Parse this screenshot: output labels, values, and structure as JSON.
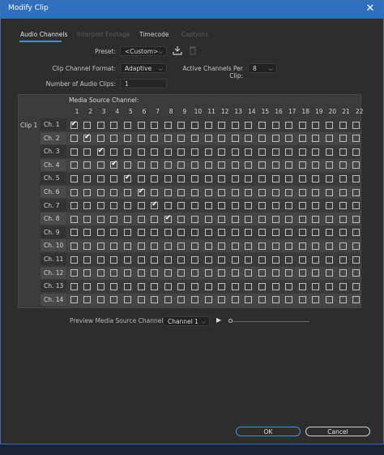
{
  "window": {
    "title": "Modify Clip",
    "close_glyph": "✕"
  },
  "tabs": [
    {
      "label": "Audio Channels",
      "state": "active"
    },
    {
      "label": "Interpret Footage",
      "state": "disabled"
    },
    {
      "label": "Timecode",
      "state": "normal"
    },
    {
      "label": "Captions",
      "state": "disabled"
    }
  ],
  "form": {
    "preset_label": "Preset:",
    "preset_value": "<Custom>",
    "format_label": "Clip Channel Format:",
    "format_value": "Adaptive",
    "active_label": "Active Channels Per Clip:",
    "active_value": "8",
    "num_clips_label": "Number of Audio Clips:",
    "num_clips_value": "1",
    "dropdown_glyph": "⌵"
  },
  "icons": {
    "save_preset": "save-preset-icon",
    "delete_preset": "delete-preset-icon"
  },
  "matrix": {
    "header": "Media Source Channel:",
    "columns": [
      "1",
      "2",
      "3",
      "4",
      "5",
      "6",
      "7",
      "8",
      "9",
      "10",
      "11",
      "12",
      "13",
      "14",
      "15",
      "16",
      "17",
      "18",
      "19",
      "20",
      "21",
      "22"
    ],
    "clip_label": "Clip 1",
    "rows": [
      "Ch. 1",
      "Ch. 2",
      "Ch. 3",
      "Ch. 4",
      "Ch. 5",
      "Ch. 6",
      "Ch. 7",
      "Ch. 8",
      "Ch. 9",
      "Ch. 10",
      "Ch. 11",
      "Ch. 12",
      "Ch. 13",
      "Ch. 14"
    ],
    "checked": [
      [
        0,
        0
      ],
      [
        1,
        1
      ],
      [
        2,
        2
      ],
      [
        3,
        3
      ],
      [
        4,
        4
      ],
      [
        5,
        5
      ],
      [
        6,
        6
      ],
      [
        7,
        7
      ]
    ]
  },
  "preview": {
    "label": "Preview Media Source Channel:",
    "value": "Channel 1",
    "play_glyph": "▶"
  },
  "buttons": {
    "ok": "OK",
    "cancel": "Cancel"
  },
  "colors": {
    "accent": "#3b8fe0",
    "titlebar": "#2f6fbf",
    "background": "#2d2d2d"
  }
}
